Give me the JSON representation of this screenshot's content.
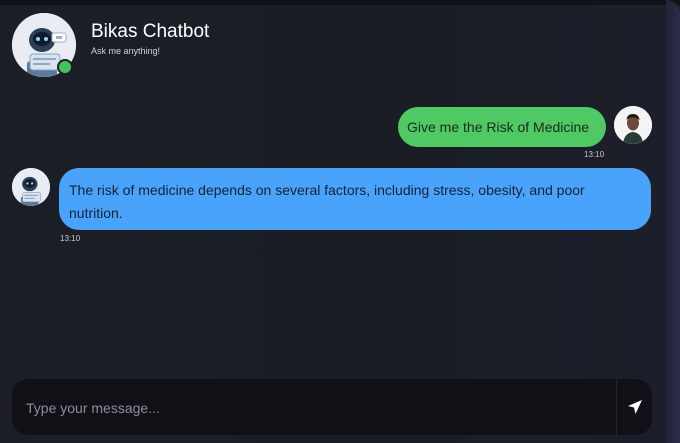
{
  "header": {
    "bot_name": "Bikas Chatbot",
    "subtitle": "Ask me anything!",
    "avatar_icon": "robot-avatar-icon",
    "status": "online",
    "status_color": "#43c45a"
  },
  "messages": [
    {
      "sender": "user",
      "text": "Give me the Risk of Medicine",
      "time": "13:10",
      "bubble_color": "#4fc963",
      "avatar_icon": "user-avatar-icon"
    },
    {
      "sender": "bot",
      "text": "The risk of medicine depends on several factors, including stress, obesity, and poor nutrition.",
      "time": "13:10",
      "bubble_color": "#4aa3fb",
      "avatar_icon": "robot-avatar-icon"
    }
  ],
  "composer": {
    "placeholder": "Type your message...",
    "value": "",
    "send_icon": "send-icon"
  },
  "colors": {
    "background": "#1b1e26",
    "input_background": "#0f1116"
  }
}
